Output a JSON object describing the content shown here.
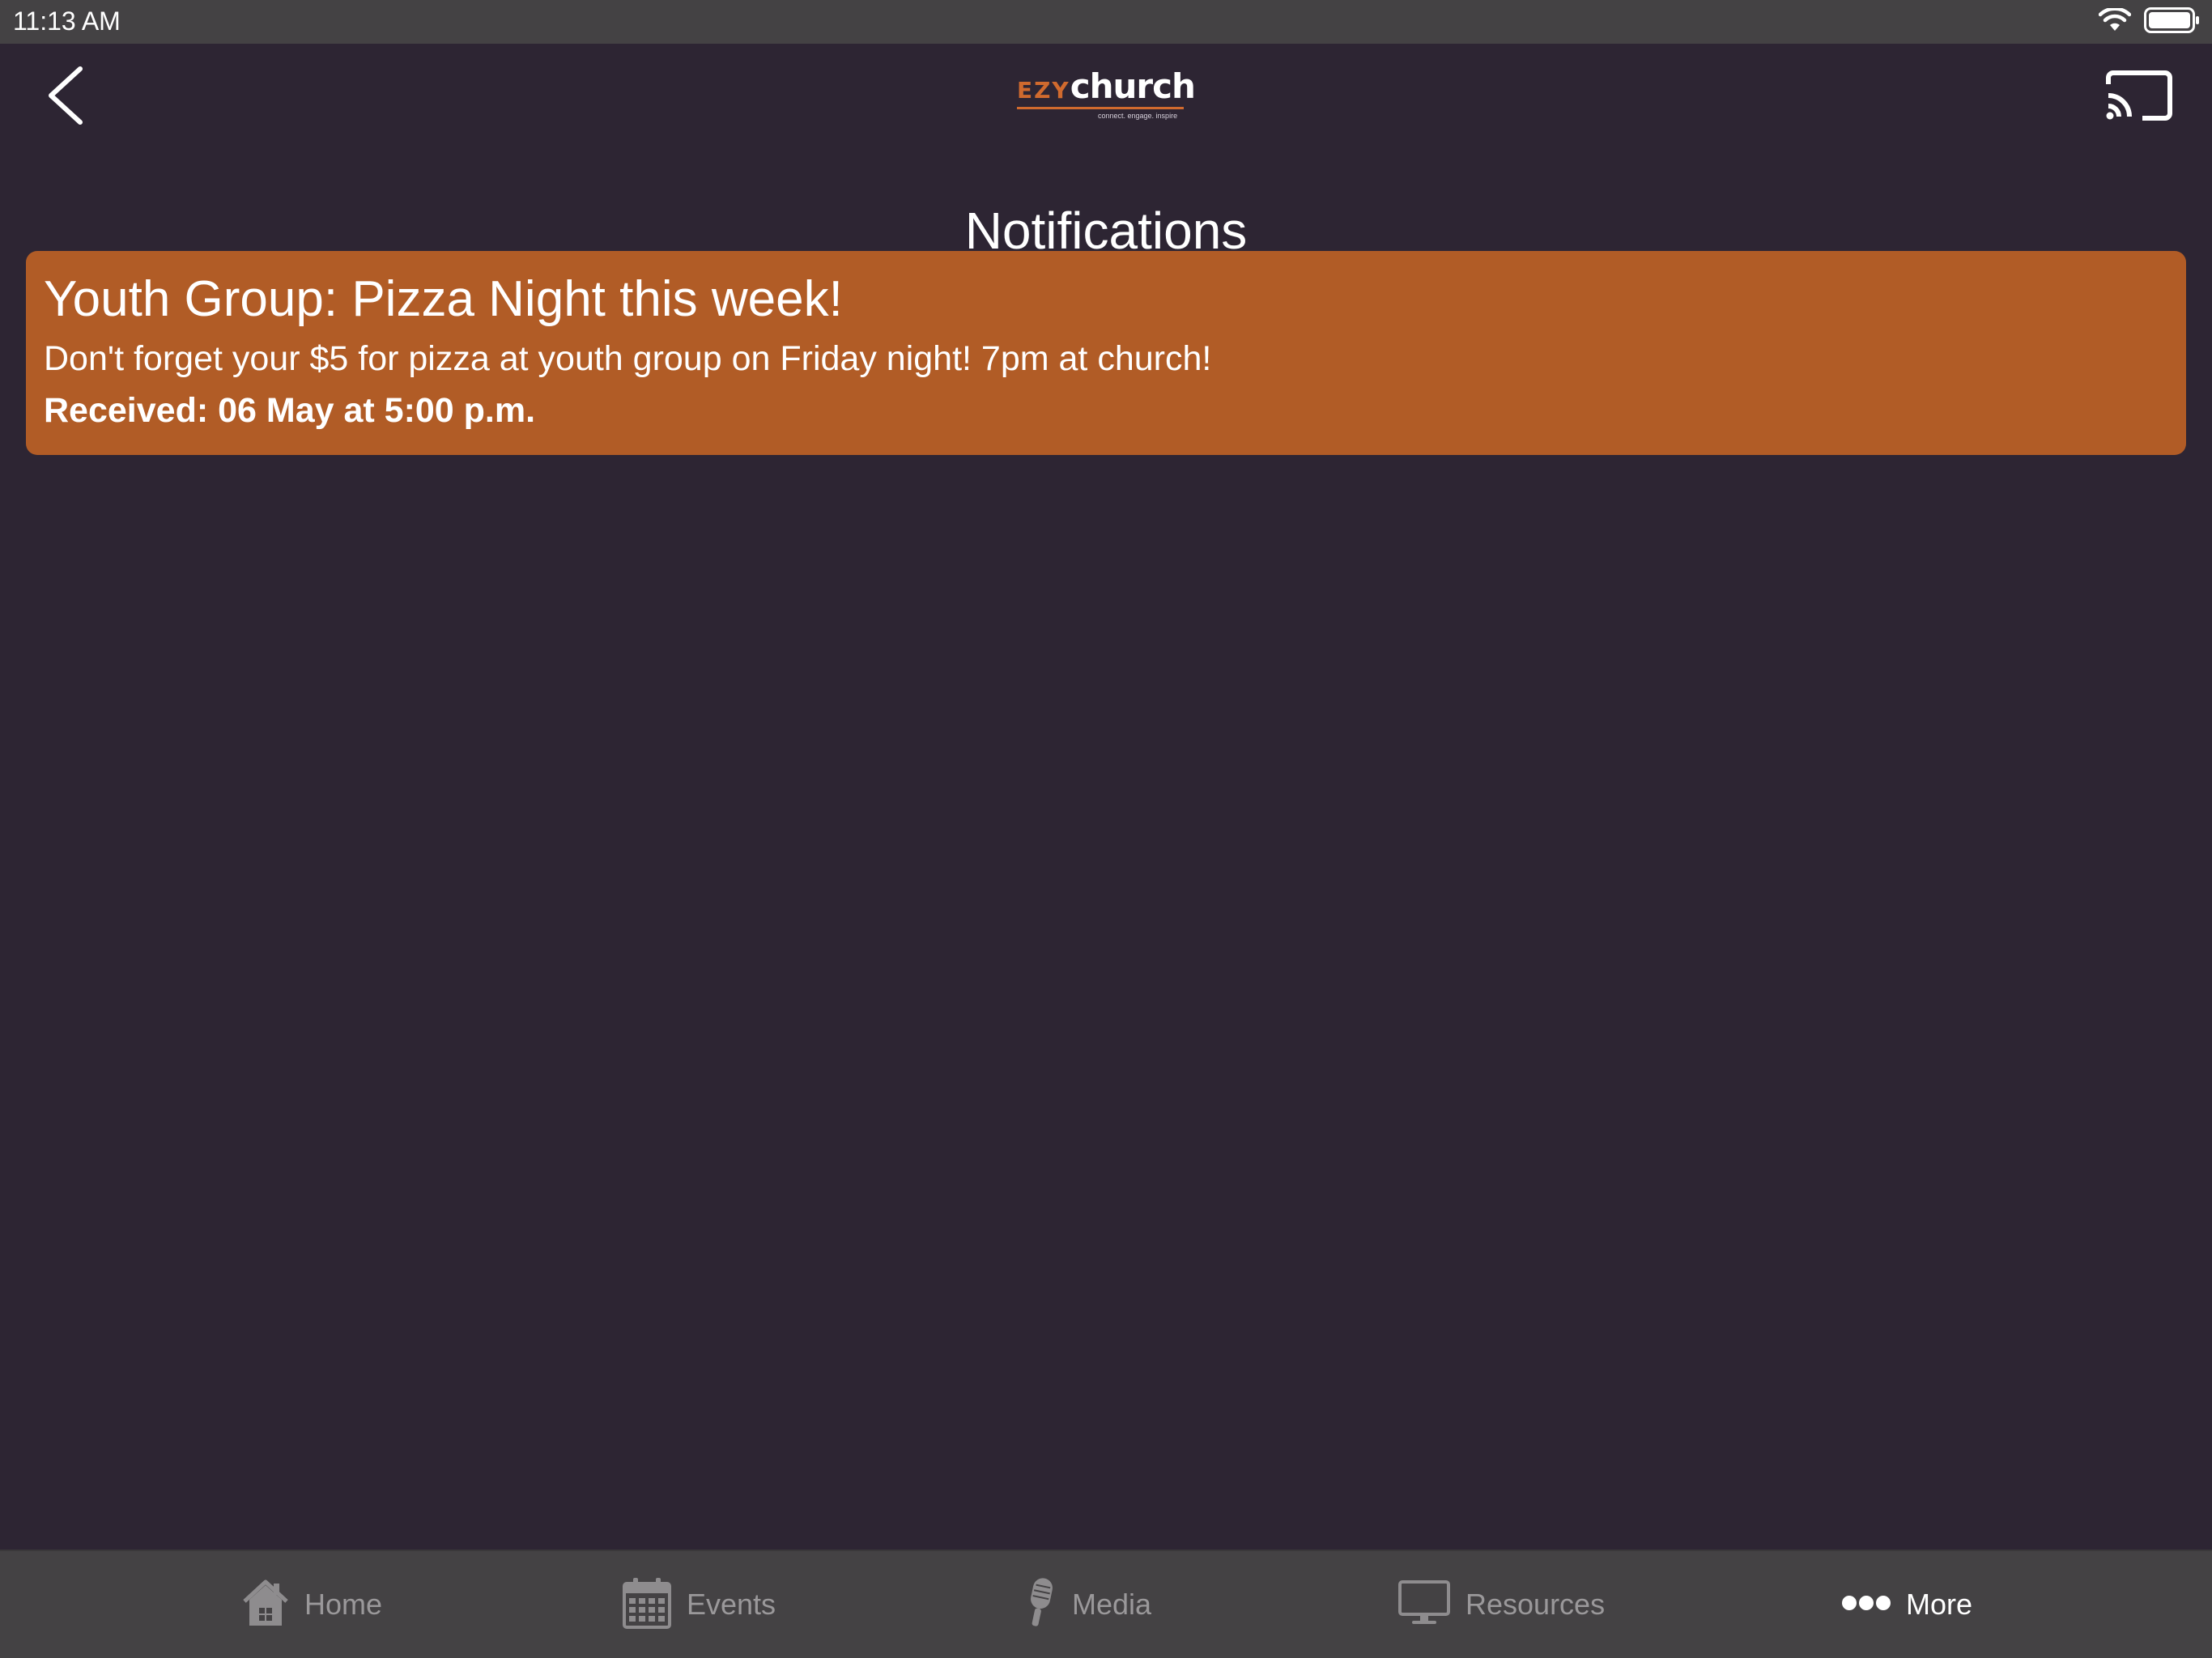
{
  "status_bar": {
    "time": "11:13 AM"
  },
  "header": {
    "logo_prefix": "EZY",
    "logo_word": "church",
    "logo_tagline": "connect. engage. inspire",
    "title": "Notifications"
  },
  "notifications": [
    {
      "title": "Youth Group: Pizza Night this week!",
      "body": "Don't forget your $5 for pizza at youth group on Friday night! 7pm at church!",
      "received": "Received: 06 May at 5:00 p.m."
    }
  ],
  "tabs": [
    {
      "label": "Home",
      "icon": "home-icon"
    },
    {
      "label": "Events",
      "icon": "calendar-icon"
    },
    {
      "label": "Media",
      "icon": "microphone-icon"
    },
    {
      "label": "Resources",
      "icon": "monitor-icon"
    },
    {
      "label": "More",
      "icon": "more-dots-icon",
      "active": true
    }
  ],
  "colors": {
    "background": "#2d2533",
    "card": "#b15c26",
    "bars": "#444244",
    "accent": "#d06a2e",
    "inactive_tab": "#9a989a"
  }
}
